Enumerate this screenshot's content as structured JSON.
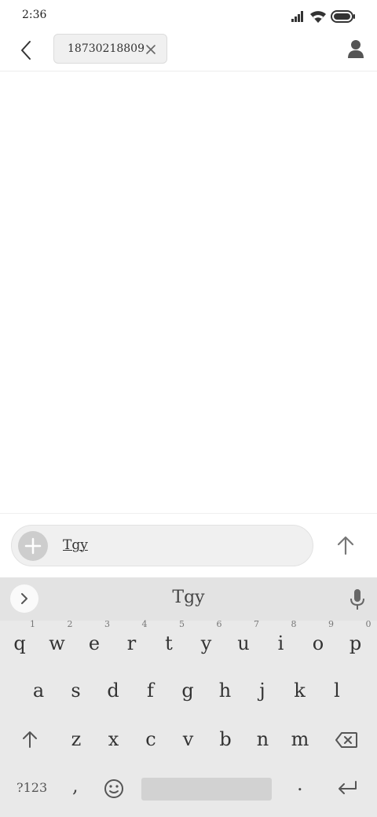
{
  "status": {
    "time": "2:36"
  },
  "header": {
    "recipient": "18730218809"
  },
  "compose": {
    "text": "Tgy"
  },
  "keyboard": {
    "suggestion": "Tgy",
    "row1": [
      {
        "k": "q",
        "hint": "1"
      },
      {
        "k": "w",
        "hint": "2"
      },
      {
        "k": "e",
        "hint": "3"
      },
      {
        "k": "r",
        "hint": "4"
      },
      {
        "k": "t",
        "hint": "5"
      },
      {
        "k": "y",
        "hint": "6"
      },
      {
        "k": "u",
        "hint": "7"
      },
      {
        "k": "i",
        "hint": "8"
      },
      {
        "k": "o",
        "hint": "9"
      },
      {
        "k": "p",
        "hint": "0"
      }
    ],
    "row2": [
      "a",
      "s",
      "d",
      "f",
      "g",
      "h",
      "j",
      "k",
      "l"
    ],
    "row3": [
      "z",
      "x",
      "c",
      "v",
      "b",
      "n",
      "m"
    ],
    "symbols_label": "?123",
    "comma": ",",
    "period": "."
  },
  "colors": {
    "keyboard_bg": "#e9e9e9",
    "icon": "#555555"
  },
  "icons": [
    "back-arrow-icon",
    "close-icon",
    "person-icon",
    "plus-icon",
    "send-arrow-icon",
    "chevron-right-icon",
    "microphone-icon",
    "shift-icon",
    "backspace-icon",
    "emoji-icon",
    "enter-icon",
    "signal-icon",
    "wifi-icon",
    "battery-icon"
  ]
}
